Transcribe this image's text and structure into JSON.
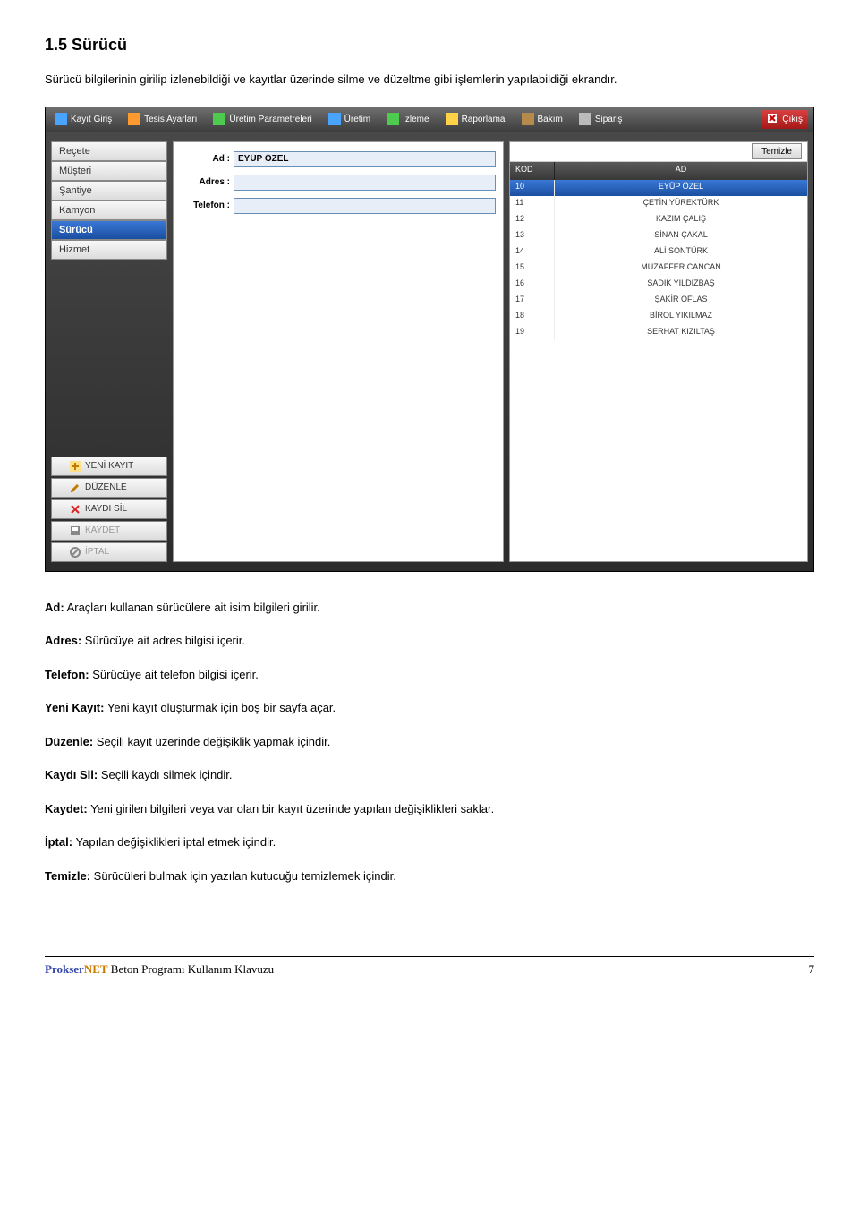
{
  "section": {
    "title": "1.5 Sürücü",
    "desc": "Sürücü bilgilerinin girilip izlenebildiği ve kayıtlar üzerinde silme ve düzeltme gibi işlemlerin yapılabildiği ekrandır."
  },
  "toolbar": {
    "items": [
      "Kayıt Giriş",
      "Tesis Ayarları",
      "Üretim Parametreleri",
      "Üretim",
      "İzleme",
      "Raporlama",
      "Bakım",
      "Sipariş"
    ],
    "exit": "Çıkış"
  },
  "sidebar": {
    "items": [
      "Reçete",
      "Müşteri",
      "Şantiye",
      "Kamyon",
      "Sürücü",
      "Hizmet"
    ],
    "active_index": 4,
    "actions": {
      "new": "YENİ KAYIT",
      "edit": "DÜZENLE",
      "del": "KAYDI SİL",
      "save": "KAYDET",
      "cancel": "İPTAL"
    }
  },
  "form": {
    "ad_label": "Ad :",
    "adres_label": "Adres :",
    "tel_label": "Telefon :",
    "ad_value": "EYÜP ÖZEL",
    "adres_value": "",
    "tel_value": ""
  },
  "list": {
    "clear": "Temizle",
    "head_kod": "KOD",
    "head_ad": "AD",
    "rows": [
      {
        "kod": "10",
        "ad": "EYÜP ÖZEL",
        "sel": true
      },
      {
        "kod": "11",
        "ad": "ÇETİN YÜREKTÜRK"
      },
      {
        "kod": "12",
        "ad": "KAZIM ÇALIŞ"
      },
      {
        "kod": "13",
        "ad": "SİNAN ÇAKAL"
      },
      {
        "kod": "14",
        "ad": "ALİ SONTÜRK"
      },
      {
        "kod": "15",
        "ad": "MUZAFFER CANCAN"
      },
      {
        "kod": "16",
        "ad": "SADIK YILDIZBAŞ"
      },
      {
        "kod": "17",
        "ad": "ŞAKİR OFLAS"
      },
      {
        "kod": "18",
        "ad": "BİROL YIKILMAZ"
      },
      {
        "kod": "19",
        "ad": "SERHAT KIZILTAŞ"
      }
    ]
  },
  "defs": [
    {
      "b": "Ad:",
      "t": " Araçları kullanan sürücülere ait isim bilgileri girilir."
    },
    {
      "b": "Adres:",
      "t": " Sürücüye ait adres bilgisi içerir."
    },
    {
      "b": "Telefon:",
      "t": " Sürücüye ait telefon bilgisi içerir."
    },
    {
      "b": "Yeni Kayıt:",
      "t": " Yeni kayıt oluşturmak için boş bir sayfa açar."
    },
    {
      "b": "Düzenle:",
      "t": " Seçili kayıt üzerinde değişiklik yapmak içindir."
    },
    {
      "b": "Kaydı Sil:",
      "t": " Seçili kaydı silmek içindir."
    },
    {
      "b": "Kaydet:",
      "t": " Yeni girilen bilgileri veya var olan bir kayıt üzerinde yapılan değişiklikleri saklar."
    },
    {
      "b": "İptal:",
      "t": " Yapılan değişiklikleri iptal etmek içindir."
    },
    {
      "b": "Temizle:",
      "t": " Sürücüleri bulmak için yazılan kutucuğu temizlemek içindir."
    }
  ],
  "footer": {
    "brand1": "Prokser",
    "brand2": "NET",
    "rest": " Beton Programı Kullanım Klavuzu",
    "page": "7"
  }
}
